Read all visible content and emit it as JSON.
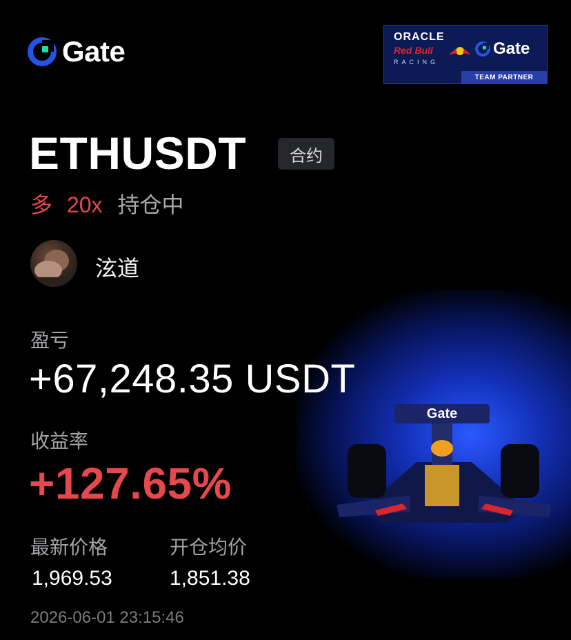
{
  "brand": {
    "name": "Gate"
  },
  "partner": {
    "line1": "ORACLE",
    "line2": "Red Bull",
    "line3": "RACING",
    "brand": "Gate",
    "footer": "TEAM PARTNER"
  },
  "position": {
    "pair": "ETHUSDT",
    "type_tag": "合约",
    "side": "多",
    "leverage": "20x",
    "status": "持仓中"
  },
  "user": {
    "name": "泫道"
  },
  "stats": {
    "pnl_label": "盈亏",
    "pnl_value": "+67,248.35 USDT",
    "roi_label": "收益率",
    "roi_value": "+127.65%",
    "last_price_label": "最新价格",
    "last_price": "1,969.53",
    "entry_price_label": "开仓均价",
    "entry_price": "1,851.38",
    "timestamp": "2026-06-01 23:15:46"
  },
  "colors": {
    "brand_blue": "#2354e6",
    "brand_green": "#17e6a1",
    "long_red": "#e5484d",
    "background": "#000000"
  }
}
